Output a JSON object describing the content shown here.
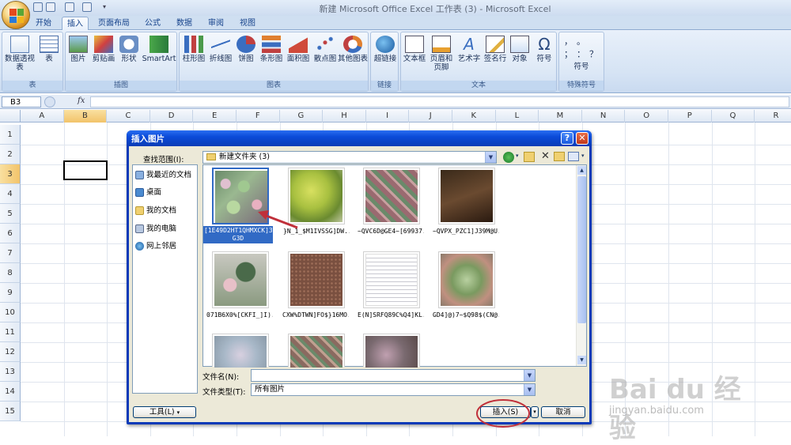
{
  "window": {
    "title": "新建 Microsoft Office Excel 工作表 (3) - Microsoft Excel"
  },
  "tabs": [
    "开始",
    "插入",
    "页面布局",
    "公式",
    "数据",
    "审阅",
    "视图"
  ],
  "active_tab": "插入",
  "ribbon": {
    "groups": [
      {
        "label": "表",
        "items": [
          "数据透视表",
          "表"
        ]
      },
      {
        "label": "插图",
        "items": [
          "图片",
          "剪贴画",
          "形状",
          "SmartArt"
        ]
      },
      {
        "label": "图表",
        "items": [
          "柱形图",
          "折线图",
          "饼图",
          "条形图",
          "面积图",
          "散点图",
          "其他图表"
        ]
      },
      {
        "label": "链接",
        "items": [
          "超链接"
        ]
      },
      {
        "label": "文本",
        "items": [
          "文本框",
          "页眉和页脚",
          "艺术字",
          "签名行",
          "对象",
          "符号"
        ]
      },
      {
        "label": "特殊符号",
        "items": [
          "符号"
        ]
      }
    ],
    "special_symbols": [
      "，",
      "。",
      "；",
      "：",
      "？"
    ]
  },
  "formula_bar": {
    "name_box": "B3",
    "fx": "fx"
  },
  "columns": [
    "A",
    "B",
    "C",
    "D",
    "E",
    "F",
    "G",
    "H",
    "I",
    "J",
    "K",
    "L",
    "M",
    "N",
    "O",
    "P",
    "Q",
    "R"
  ],
  "rows": [
    "1",
    "2",
    "3",
    "4",
    "5",
    "6",
    "7",
    "8",
    "9",
    "10",
    "11",
    "12",
    "13",
    "14",
    "15"
  ],
  "dialog": {
    "title": "插入图片",
    "lookin_label": "查找范围(I):",
    "lookin_value": "新建文件夹 (3)",
    "places": [
      "我最近的文档",
      "桌面",
      "我的文档",
      "我的电脑",
      "网上邻居"
    ],
    "files": [
      "[1E49D2HT1QHMXCK]3X G3D",
      "}N_1_$M1IVSSG]DW...",
      "~QVC6D@GE4~[69937...",
      "~QVPX_PZC1]J39M@U...",
      "071B6X0%[CKFI_]I)...",
      "CXW%DTWN]FO$}16MO...",
      "E(N]SRFQ89C%Q4]KL...",
      "GD4]@)7~$Q98$(CN@...",
      "",
      "",
      ""
    ],
    "filename_label": "文件名(N):",
    "filename_value": "",
    "filetype_label": "文件类型(T):",
    "filetype_value": "所有图片",
    "tools_button": "工具(L)",
    "insert_button": "插入(S)",
    "cancel_button": "取消"
  },
  "watermark": {
    "logo": "Bai du 经验",
    "url": "jingyan.baidu.com"
  },
  "colors": {
    "accent": "#0a3cb6",
    "ribbon": "#d5e3f4",
    "annotation": "#c0303a"
  }
}
